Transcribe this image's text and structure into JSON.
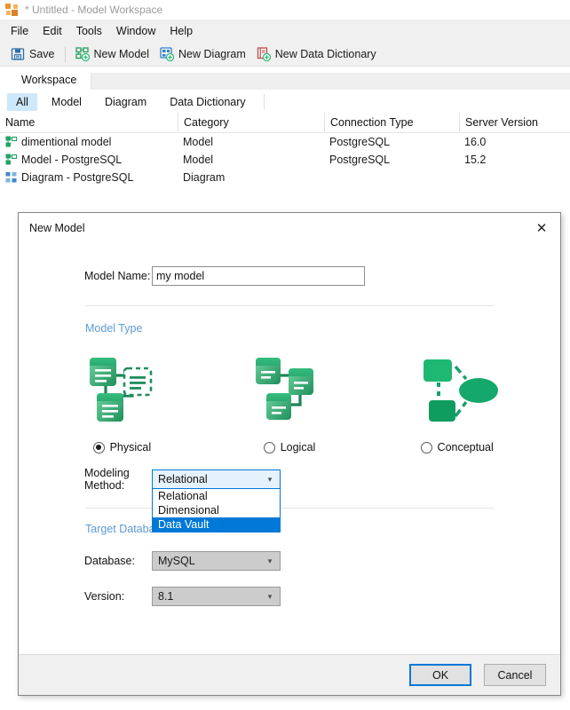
{
  "window": {
    "title": "* Untitled - Model Workspace",
    "app_icon": "app-nodes-icon"
  },
  "menubar": {
    "items": [
      {
        "label": "File"
      },
      {
        "label": "Edit"
      },
      {
        "label": "Tools"
      },
      {
        "label": "Window"
      },
      {
        "label": "Help"
      }
    ]
  },
  "toolbar": {
    "buttons": [
      {
        "label": "Save",
        "icon": "floppy-disk-save-icon"
      },
      {
        "label": "New Model",
        "icon": "new-model-icon"
      },
      {
        "label": "New Diagram",
        "icon": "new-diagram-icon"
      },
      {
        "label": "New Data Dictionary",
        "icon": "new-data-dictionary-icon"
      }
    ]
  },
  "workspace_tabs": [
    {
      "label": "Workspace",
      "selected": true
    }
  ],
  "filter_tabs": [
    {
      "label": "All",
      "selected": true
    },
    {
      "label": "Model",
      "selected": false
    },
    {
      "label": "Diagram",
      "selected": false
    },
    {
      "label": "Data Dictionary",
      "selected": false
    }
  ],
  "table": {
    "columns": [
      "Name",
      "Category",
      "Connection Type",
      "Server Version"
    ],
    "rows": [
      {
        "icon": "model-node-icon",
        "name": "dimentional model",
        "category": "Model",
        "connection_type": "PostgreSQL",
        "server_version": "16.0"
      },
      {
        "icon": "model-node-icon",
        "name": "Model - PostgreSQL",
        "category": "Model",
        "connection_type": "PostgreSQL",
        "server_version": "15.2"
      },
      {
        "icon": "diagram-node-icon",
        "name": "Diagram - PostgreSQL",
        "category": "Diagram",
        "connection_type": "",
        "server_version": ""
      }
    ]
  },
  "dialog": {
    "title": "New Model",
    "close_icon": "close-icon",
    "model_name": {
      "label": "Model Name:",
      "value": "my model",
      "placeholder": ""
    },
    "model_type": {
      "section_label": "Model Type",
      "options": [
        {
          "label": "Physical",
          "selected": true,
          "icon": "physical-model-icon"
        },
        {
          "label": "Logical",
          "selected": false,
          "icon": "logical-model-icon"
        },
        {
          "label": "Conceptual",
          "selected": false,
          "icon": "conceptual-model-icon"
        }
      ]
    },
    "modeling_method": {
      "label": "Modeling Method:",
      "value": "Relational",
      "expanded": true,
      "options": [
        {
          "label": "Relational",
          "highlighted": false
        },
        {
          "label": "Dimensional",
          "highlighted": false
        },
        {
          "label": "Data Vault",
          "highlighted": true
        }
      ]
    },
    "target_database": {
      "section_label": "Target Database",
      "database": {
        "label": "Database:",
        "value": "MySQL",
        "disabled": true
      },
      "version": {
        "label": "Version:",
        "value": "8.1",
        "disabled": true
      }
    },
    "buttons": {
      "ok": "OK",
      "cancel": "Cancel"
    }
  },
  "colors": {
    "accent_blue": "#0078d7",
    "section_label_blue": "#5b9bd5",
    "tab_highlight": "#cde8fb",
    "model_green": "#21a366",
    "diagram_blue": "#2f7fd1",
    "app_orange": "#e8962e",
    "dict_red": "#c0504d"
  }
}
